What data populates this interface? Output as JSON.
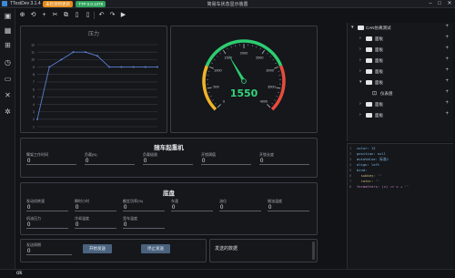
{
  "window": {
    "app_name": "TTestDev 3.1.4",
    "badge_status": "未检测到更新",
    "badge_version": "TTP 0.0.1378",
    "title": "简易车状态显示装置",
    "controls": [
      "–",
      "□",
      "✕"
    ]
  },
  "toolbar": {
    "buttons": [
      "⊕",
      "⟲",
      "+",
      "✂",
      "⧉",
      "▯",
      "▯",
      "↶",
      "↷",
      "▶"
    ]
  },
  "sidebar": {
    "icons": [
      "layout-icon",
      "table-icon",
      "tree-icon",
      "history-icon",
      "monitor-icon",
      "tools-icon",
      "settings-icon"
    ]
  },
  "line_chart": {
    "title": "压力",
    "chart_data": {
      "type": "line",
      "title": "压力",
      "x": [
        0,
        1,
        2,
        3,
        4,
        5,
        6,
        7,
        8,
        9,
        10
      ],
      "series": [
        {
          "values": [
            2,
            9,
            10,
            11,
            11,
            10.5,
            9,
            9,
            9,
            9,
            9
          ]
        }
      ],
      "ylim": [
        1,
        12
      ],
      "y_ticks": [
        "12",
        "11",
        "10",
        "9",
        "8",
        "7",
        "6",
        "5",
        "4",
        "3",
        "2",
        "1"
      ],
      "grid": true,
      "line_color": "#5a7fd0"
    }
  },
  "gauge": {
    "value": "1550",
    "min": 0,
    "max": 4000,
    "ticks": [
      "0",
      "500",
      "1000",
      "1500",
      "2000",
      "2500",
      "3000",
      "3500",
      "4000"
    ],
    "needle_value": 1550,
    "colors": {
      "low": "#f0b429",
      "mid": "#2ecc71",
      "high": "#e74c3c"
    }
  },
  "crane": {
    "title": "随车起重机",
    "fields": [
      {
        "label": "臂架工作时间",
        "value": "0"
      },
      {
        "label": "负载(N)",
        "value": "0"
      },
      {
        "label": "负载极限",
        "value": "0"
      },
      {
        "label": "开锁阈值",
        "value": "0"
      },
      {
        "label": "开锁长度",
        "value": "0"
      }
    ]
  },
  "chassis": {
    "title": "底盘",
    "row1": [
      {
        "label": "发动机转速",
        "value": "0"
      },
      {
        "label": "瞬时小时",
        "value": "0"
      },
      {
        "label": "额定功率(%)",
        "value": "0"
      },
      {
        "label": "车速",
        "value": "0"
      },
      {
        "label": "油位",
        "value": "0"
      },
      {
        "label": "燃油温度",
        "value": "0"
      }
    ],
    "row2": [
      {
        "label": "机油压力",
        "value": "0"
      },
      {
        "label": "冷却温度",
        "value": "0"
      },
      {
        "label": "里车温度",
        "value": "0"
      }
    ]
  },
  "send": {
    "label": "发送周期",
    "value": "0",
    "start_button": "开始发送",
    "stop_button": "停止发送",
    "data_title": "发送的数据"
  },
  "tree": {
    "root": "CAN仿真测试",
    "items": [
      "面板",
      "面板",
      "面板",
      "面板",
      "面板",
      "仪表盘",
      "面板",
      "面板"
    ]
  },
  "code": {
    "lines": [
      {
        "n": "1",
        "text": "color: 12"
      },
      {
        "n": "2",
        "text": "position: null"
      },
      {
        "n": "3",
        "text": "autoValue: 标准1"
      },
      {
        "n": "4",
        "text": "align: left"
      },
      {
        "n": "5",
        "text": "bind:"
      },
      {
        "n": "6",
        "text": "  subkey: ''"
      },
      {
        "n": "7",
        "text": "  rotor: ''"
      },
      {
        "n": "8",
        "text": "formatters: (v) => v + ''"
      }
    ]
  },
  "status": {
    "text": "ok"
  }
}
